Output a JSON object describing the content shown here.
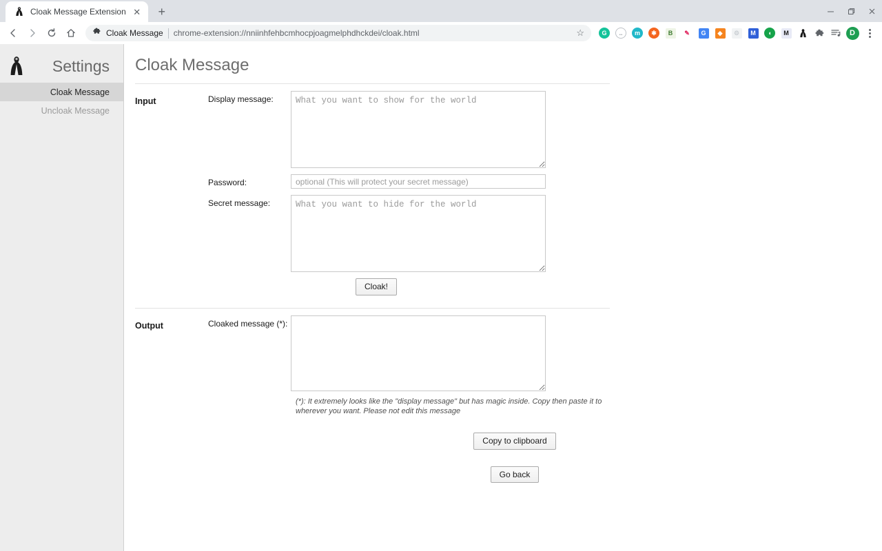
{
  "window": {
    "minimize_label": "–",
    "maximize_label": "❐",
    "close_label": "✕"
  },
  "browser": {
    "tab": {
      "title": "Cloak Message Extension",
      "favicon_name": "cloak-figure-favicon",
      "close_label": "✕"
    },
    "new_tab_label": "+",
    "nav": {
      "back_label": "←",
      "forward_label": "→",
      "reload_label": "↻",
      "home_label": "⌂"
    },
    "omnibox": {
      "extension_name": "Cloak Message",
      "url": "chrome-extension://nniinhfehbcmhocpjoagmelphdhckdei/cloak.html",
      "bookmark_star": "☆",
      "puzzle_icon_label": "❖"
    },
    "extensions": [
      {
        "name": "grammarly-extension-icon",
        "glyph": "G",
        "bg": "#15c39a",
        "shape": "circle"
      },
      {
        "name": "smiley-extension-icon",
        "glyph": "◌",
        "bg": "#ffffff",
        "fg": "#9aa0a6",
        "shape": "circle"
      },
      {
        "name": "mendeley-extension-icon",
        "glyph": "m",
        "bg": "#21b8c9",
        "shape": "circle"
      },
      {
        "name": "orange-badge-extension-icon",
        "glyph": "✖",
        "bg": "#f4651f",
        "shape": "circle"
      },
      {
        "name": "bitwarden-extension-icon",
        "glyph": "B",
        "bg": "#f3f6ed",
        "fg": "#3d7a2e",
        "shape": "square"
      },
      {
        "name": "color-pen-extension-icon",
        "glyph": "✒",
        "bg": "#ffffff",
        "fg": "#e0245e",
        "shape": "square"
      },
      {
        "name": "google-translate-extension-icon",
        "glyph": "G",
        "bg": "#4285f4",
        "shape": "square"
      },
      {
        "name": "metamask-fox-extension-icon",
        "glyph": "⬟",
        "bg": "#f5841f",
        "shape": "square"
      },
      {
        "name": "gear-disabled-extension-icon",
        "glyph": "⚙",
        "bg": "#f1f3f4",
        "fg": "#c9cdd2",
        "shape": "square"
      },
      {
        "name": "mega-extension-icon",
        "glyph": "M",
        "bg": "#2f5fd8",
        "shape": "square"
      },
      {
        "name": "duckduckgo-extension-icon",
        "glyph": "◑",
        "bg": "#16a34a",
        "shape": "circle"
      },
      {
        "name": "marker-m-extension-icon",
        "glyph": "M",
        "bg": "#e8eaf6",
        "fg": "#222222",
        "shape": "square"
      },
      {
        "name": "cloak-message-extension-icon",
        "glyph": "♟",
        "bg": "#ffffff",
        "fg": "#202020",
        "shape": "square"
      },
      {
        "name": "extensions-puzzle-icon",
        "glyph": "❖",
        "bg": "#ffffff",
        "fg": "#5f6368",
        "shape": "square"
      },
      {
        "name": "reading-list-icon",
        "glyph": "≣",
        "bg": "#ffffff",
        "fg": "#5f6368",
        "shape": "square"
      }
    ],
    "profile": {
      "initial": "D",
      "bg": "#1e9e52"
    },
    "menu_label": "⋮"
  },
  "sidebar": {
    "logo_name": "cloaked-figure-logo",
    "title": "Settings",
    "items": [
      {
        "label": "Cloak Message",
        "active": true
      },
      {
        "label": "Uncloak Message",
        "active": false
      }
    ]
  },
  "page": {
    "title": "Cloak Message",
    "input_section": {
      "label": "Input",
      "display_message": {
        "label": "Display message:",
        "placeholder": "What you want to show for the world",
        "value": ""
      },
      "password": {
        "label": "Password:",
        "placeholder": "optional (This will protect your secret message)",
        "value": ""
      },
      "secret_message": {
        "label": "Secret message:",
        "placeholder": "What you want to hide for the world",
        "value": ""
      },
      "cloak_button": "Cloak!"
    },
    "output_section": {
      "label": "Output",
      "cloaked_message": {
        "label": "Cloaked message (*):",
        "placeholder": "",
        "value": ""
      },
      "note": "(*): It extremely looks like the \"display message\" but has magic inside. Copy then paste it to wherever you want. Please not edit this message",
      "copy_button": "Copy to clipboard",
      "go_back_button": "Go back"
    }
  }
}
